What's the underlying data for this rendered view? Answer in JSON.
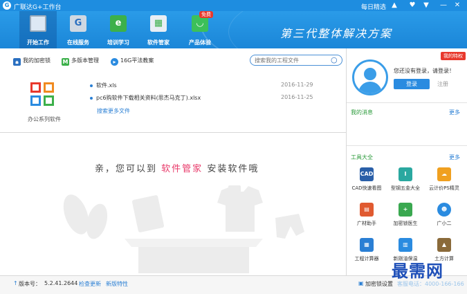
{
  "window": {
    "title": "广联达G+工作台",
    "daily_pick": "每日精选"
  },
  "nav": {
    "items": [
      {
        "label": "开始工作",
        "icon": "monitor-icon",
        "color": "#3a9de8"
      },
      {
        "label": "在线服务",
        "icon": "g-service-icon",
        "color": "#4a9ad8"
      },
      {
        "label": "培训学习",
        "icon": "e-learning-icon",
        "color": "#3cb04a"
      },
      {
        "label": "软件管家",
        "icon": "software-manager-icon",
        "color": "#3cb04a"
      },
      {
        "label": "产品体验",
        "icon": "shopping-bag-icon",
        "color": "#3cc05a"
      }
    ],
    "free_badge": "免费",
    "slogan": "第三代整体解决方案"
  },
  "subbar": {
    "my_lock": "我的加密锁",
    "multi_version": "多版本管理",
    "free_textbook": "16G平法教案",
    "search_placeholder": "搜索我的工程文件"
  },
  "recent": {
    "office_label": "办公系列软件",
    "files": [
      {
        "name": "软件.xls",
        "date": "2016-11-29"
      },
      {
        "name": "pc6购软件下载相关资料(思杰马克丁).xlsx",
        "date": "2016-11-25"
      }
    ],
    "more": "搜索更多文件"
  },
  "promo": {
    "pre": "亲，您可以到",
    "highlight": "软件管家",
    "post": "安装软件哦"
  },
  "right": {
    "tag": "我的特权",
    "login_hint": "您还没有登录，请登录！",
    "login": "登录",
    "register": "注册",
    "messages_title": "我的消息",
    "messages_more": "更多",
    "tools_title": "工具大全",
    "tools_more": "更多",
    "tools": [
      {
        "label": "CAD快速看图",
        "icon": "cad-icon",
        "color": "#2a5fa8"
      },
      {
        "label": "型钢五金大全",
        "icon": "steel-icon",
        "color": "#2aa8a0"
      },
      {
        "label": "云计价PS精灵",
        "icon": "cloud-price-icon",
        "color": "#f0a020"
      },
      {
        "label": "广材助手",
        "icon": "material-icon",
        "color": "#e05a30"
      },
      {
        "label": "加密锁医生",
        "icon": "lock-doctor-icon",
        "color": "#3aa850"
      },
      {
        "label": "广小二",
        "icon": "assistant-icon",
        "color": "#2a8be0"
      },
      {
        "label": "工程计算器",
        "icon": "calculator-icon",
        "color": "#2a7fd4"
      },
      {
        "label": "新刚油保温",
        "icon": "insulation-icon",
        "color": "#2a8be0"
      },
      {
        "label": "土方计算",
        "icon": "earthwork-icon",
        "color": "#8a6a3a"
      }
    ]
  },
  "status": {
    "version_label": "版本号：",
    "version": "5.2.41.2644",
    "check_update": "检查更新",
    "new_features": "新版特性",
    "lock_service": "加密锁设置",
    "hotline": "客服电话：4000-166-166"
  },
  "watermark": "最需网"
}
